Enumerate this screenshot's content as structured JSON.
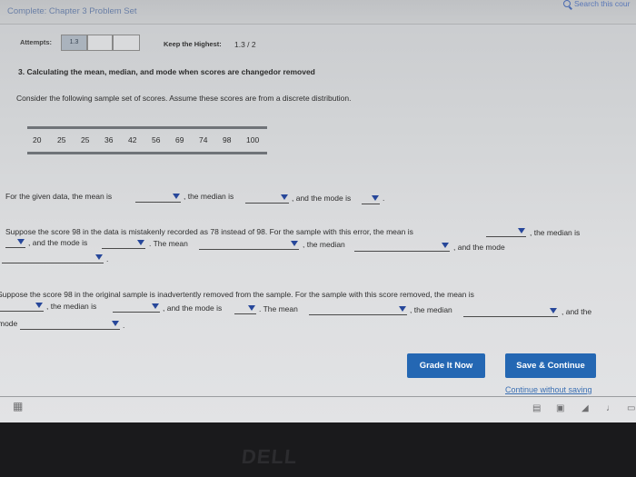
{
  "header": {
    "course_title": "Complete: Chapter 3 Problem Set",
    "search_text": "Search this cour"
  },
  "attempts": {
    "label": "Attempts:",
    "first_box": "1.3",
    "keep_label": "Keep the Highest:",
    "keep_value": "1.3 / 2"
  },
  "question": {
    "title": "3. Calculating the mean, median, and mode when scores are changedor removed",
    "instruction": "Consider the following sample set of scores. Assume these scores are from a discrete distribution."
  },
  "scores": [
    "20",
    "25",
    "25",
    "36",
    "42",
    "56",
    "69",
    "74",
    "98",
    "100"
  ],
  "part1": {
    "t1": "For the given data, the mean is",
    "t2": ", the median is",
    "t3": ", and the mode is",
    "t4": "."
  },
  "part2": {
    "t1": "Suppose the score 98 in the data is mistakenly recorded as 78 instead of 98. For the sample with this error, the mean is",
    "t2": ", the median is",
    "t3": ", and the mode is",
    "t4": ". The mean",
    "t5": ", the median",
    "t6": ", and the mode",
    "t7": "."
  },
  "part3": {
    "t1": "Suppose the score 98 in the original sample is inadvertently removed from the sample. For the sample with this score removed, the mean is",
    "t2": ", the median is",
    "t3": ", and the mode is",
    "t4": ". The mean",
    "t5": ", the median",
    "t6": ", and the",
    "t7": "mode",
    "t8": "."
  },
  "buttons": {
    "grade": "Grade It Now",
    "save": "Save & Continue",
    "continue_link": "Continue without saving"
  },
  "bezel": {
    "brand": "DELL"
  },
  "colors": {
    "button_blue": "#2467b3",
    "dropdown_arrow": "#27479a"
  }
}
